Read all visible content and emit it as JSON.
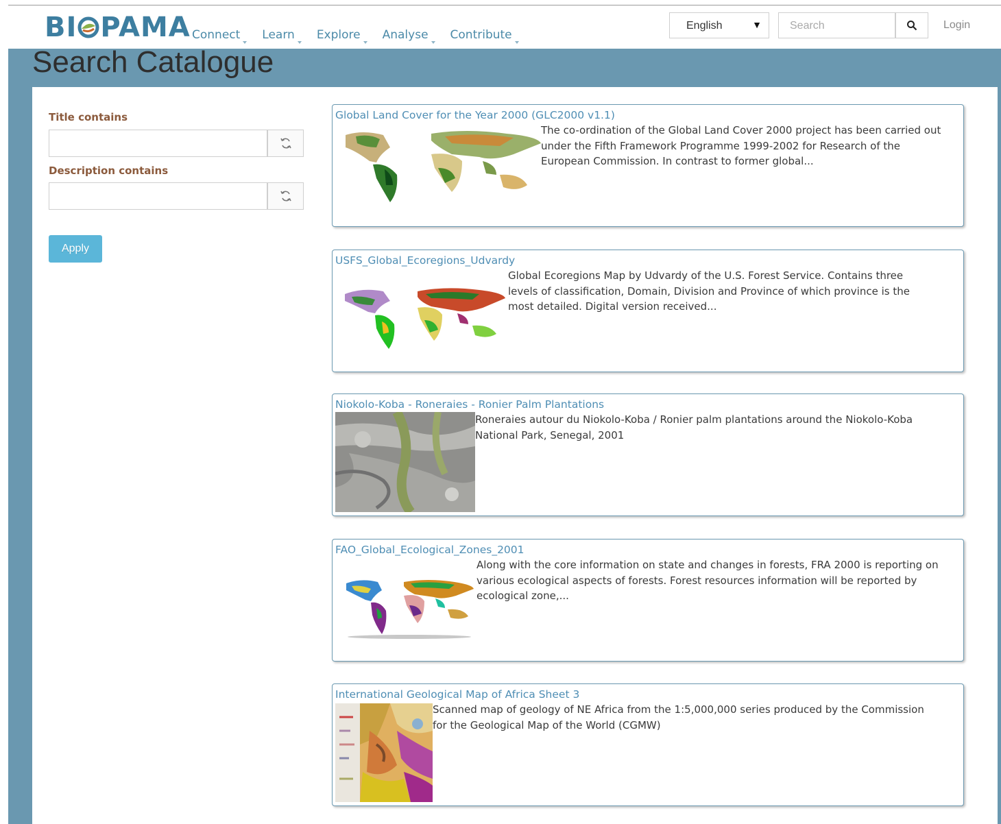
{
  "header": {
    "logo_text_left": "BI",
    "logo_text_right": "PAMA",
    "nav": [
      {
        "label": "Connect"
      },
      {
        "label": "Learn"
      },
      {
        "label": "Explore"
      },
      {
        "label": "Analyse"
      },
      {
        "label": "Contribute"
      }
    ],
    "language": "English",
    "search_placeholder": "Search",
    "login": "Login"
  },
  "page": {
    "title": "Search Catalogue"
  },
  "filters": {
    "title_label": "Title contains",
    "description_label": "Description contains",
    "apply_label": "Apply"
  },
  "results": [
    {
      "title": "Global Land Cover for the Year 2000 (GLC2000 v1.1)",
      "lines": [
        "The co-ordination of the Global Land Cover 2000 project has been carried out",
        "under the Fifth Framework Programme 1999-2002 for Research of the",
        "European Commission. In contrast to former global..."
      ],
      "thumb": "world-map-landcover"
    },
    {
      "title": "USFS_Global_Ecoregions_Udvardy",
      "lines": [
        "Global Ecoregions Map by Udvardy of the U.S. Forest Service. Contains three",
        "levels of classification, Domain, Division and Province of which province is the",
        "most detailed. Digital version received..."
      ],
      "thumb": "world-map-ecoregions"
    },
    {
      "title": "Niokolo-Koba - Roneraies - Ronier Palm Plantations",
      "lines": [
        "Roneraies autour du Niokolo-Koba / Ronier palm plantations around the Niokolo-Koba",
        "National Park, Senegal, 2001"
      ],
      "thumb": "satellite-image"
    },
    {
      "title": "FAO_Global_Ecological_Zones_2001",
      "lines": [
        "Along with the core information on state and changes in forests, FRA 2000 is reporting on",
        "various ecological aspects of forests. Forest resources information will be reported by",
        "ecological zone,..."
      ],
      "thumb": "world-map-ecozones"
    },
    {
      "title": "International Geological Map of Africa Sheet 3",
      "lines": [
        "Scanned map of geology of NE Africa from the 1:5,000,000 series produced by the Commission",
        "for the Geological Map of the World (CGMW)"
      ],
      "thumb": "geology-map"
    }
  ],
  "colors": {
    "brand": "#3d7ea0",
    "banner": "#6a98b0",
    "link": "#4f8eb4",
    "label": "#8b5a3c",
    "apply": "#5bb6d9"
  }
}
